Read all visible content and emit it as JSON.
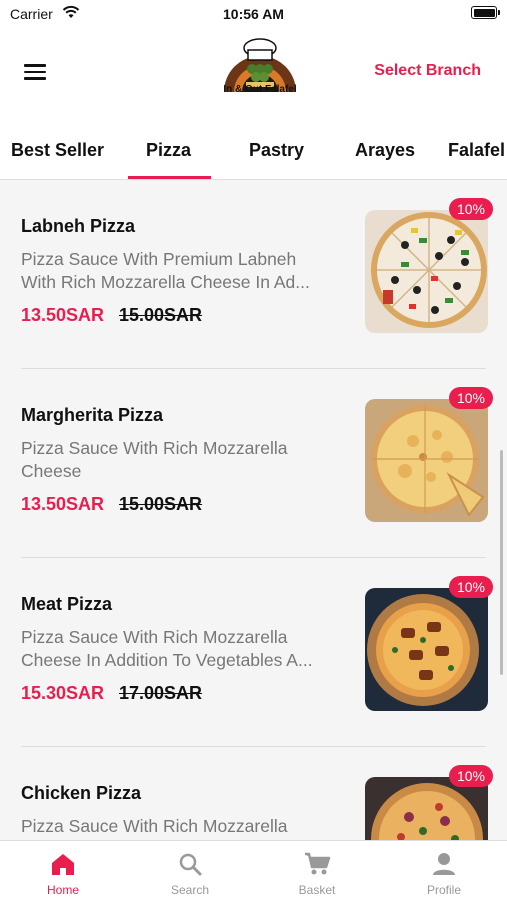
{
  "status_bar": {
    "carrier": "Carrier",
    "time": "10:56 AM"
  },
  "header": {
    "logo_text": "In & Out Falafel",
    "select_branch": "Select Branch"
  },
  "tabs": [
    {
      "label": "Best Seller",
      "active": false
    },
    {
      "label": "Pizza",
      "active": true
    },
    {
      "label": "Pastry",
      "active": false
    },
    {
      "label": "Arayes",
      "active": false
    },
    {
      "label": "Falafel",
      "active": false
    }
  ],
  "items": [
    {
      "name": "Labneh Pizza",
      "description_line1": "Pizza Sauce With Premium Labneh",
      "description_line2": "With Rich Mozzarella Cheese In Ad...",
      "price": "13.50SAR",
      "old_price": "15.00SAR",
      "discount": "10%",
      "image_icon": "veggie-pizza-image"
    },
    {
      "name": "Margherita Pizza",
      "description_line1": "Pizza Sauce With Rich Mozzarella",
      "description_line2": "Cheese",
      "price": "13.50SAR",
      "old_price": "15.00SAR",
      "discount": "10%",
      "image_icon": "cheese-pizza-image"
    },
    {
      "name": "Meat Pizza",
      "description_line1": "Pizza Sauce With Rich Mozzarella",
      "description_line2": "Cheese In Addition To Vegetables A...",
      "price": "15.30SAR",
      "old_price": "17.00SAR",
      "discount": "10%",
      "image_icon": "meat-pizza-image"
    },
    {
      "name": "Chicken Pizza",
      "description_line1": "Pizza Sauce With Rich Mozzarella",
      "description_line2": "",
      "price": "",
      "old_price": "",
      "discount": "10%",
      "image_icon": "chicken-pizza-image"
    }
  ],
  "bottom_nav": [
    {
      "label": "Home",
      "icon": "home-icon",
      "active": true
    },
    {
      "label": "Search",
      "icon": "search-icon",
      "active": false
    },
    {
      "label": "Basket",
      "icon": "cart-icon",
      "active": false
    },
    {
      "label": "Profile",
      "icon": "profile-icon",
      "active": false
    }
  ],
  "colors": {
    "accent": "#e91e4e",
    "text": "#111111",
    "muted": "#777777",
    "background": "#f5f5f5"
  }
}
